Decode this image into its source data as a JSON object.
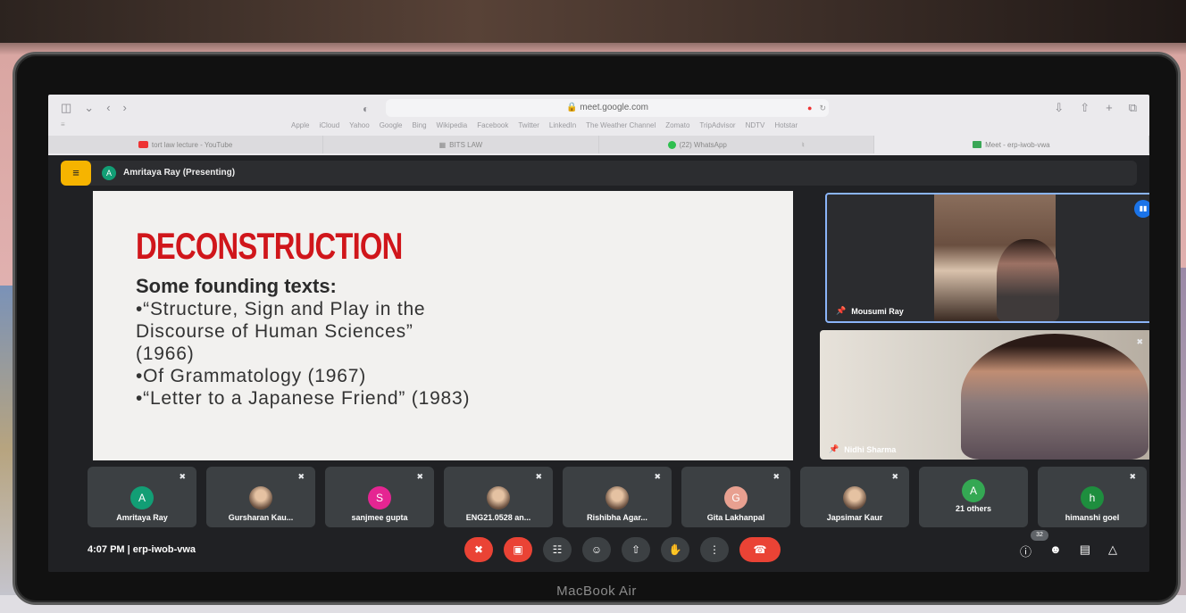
{
  "laptop": {
    "model_label": "MacBook Air"
  },
  "browser": {
    "url": "meet.google.com",
    "bookmarks": [
      "Apple",
      "iCloud",
      "Yahoo",
      "Google",
      "Bing",
      "Wikipedia",
      "Facebook",
      "Twitter",
      "LinkedIn",
      "The Weather Channel",
      "Zomato",
      "TripAdvisor",
      "NDTV",
      "Hotstar"
    ],
    "tabs": [
      {
        "label": "tort law lecture - YouTube",
        "icon": "youtube-icon"
      },
      {
        "label": "BITS LAW",
        "icon": "page-icon"
      },
      {
        "label": "(22) WhatsApp",
        "icon": "whatsapp-icon"
      },
      {
        "label": "Meet - erp-iwob-vwa",
        "icon": "meet-icon"
      }
    ]
  },
  "meet": {
    "presenter": {
      "initial": "A",
      "label": "Amritaya Ray (Presenting)"
    },
    "slide": {
      "title": "DECONSTRUCTION",
      "subtitle": "Some founding texts:",
      "lines": [
        "•“Structure, Sign and Play in the",
        "Discourse of Human Sciences”",
        "(1966)",
        "•Of Grammatology (1967)",
        "•“Letter to a Japanese Friend” (1983)"
      ]
    },
    "video_tiles": [
      {
        "name": "Mousumi Ray"
      },
      {
        "name": "Nidhi Sharma"
      }
    ],
    "participants": [
      {
        "name": "Amritaya Ray",
        "initial": "A",
        "color": "#129e75",
        "photo": false
      },
      {
        "name": "Gursharan Kau...",
        "initial": "",
        "color": "",
        "photo": true
      },
      {
        "name": "sanjmee gupta",
        "initial": "S",
        "color": "#e52592",
        "photo": false
      },
      {
        "name": "ENG21.0528 an...",
        "initial": "",
        "color": "",
        "photo": true
      },
      {
        "name": "Rishibha Agar...",
        "initial": "",
        "color": "",
        "photo": true
      },
      {
        "name": "Gita Lakhanpal",
        "initial": "G",
        "color": "#e8a090",
        "photo": false
      },
      {
        "name": "Japsimar Kaur",
        "initial": "",
        "color": "",
        "photo": true
      },
      {
        "name": "21 others",
        "initial": "A",
        "color": "#34a853",
        "photo": false
      },
      {
        "name": "himanshi goel",
        "initial": "h",
        "color": "#1e8e3e",
        "photo": false
      }
    ],
    "bottom": {
      "time_code": "4:07 PM  |  erp-iwob-vwa",
      "people_count": "32"
    }
  }
}
